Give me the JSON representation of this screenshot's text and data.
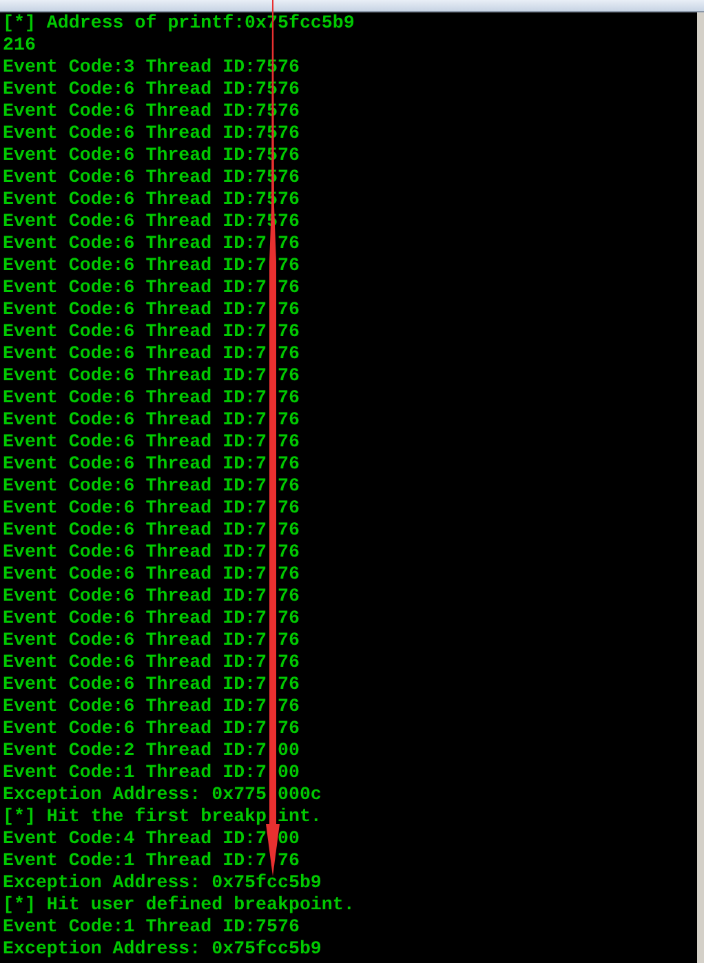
{
  "console": {
    "lines": [
      {
        "parts": [
          "[*] Address of printf:0x75fcc5b9"
        ]
      },
      {
        "parts": [
          "216"
        ]
      },
      {
        "parts": [
          "Event Code:3 Thread ID:7576"
        ]
      },
      {
        "parts": [
          "Event Code:6 Thread ID:7576"
        ]
      },
      {
        "parts": [
          "Event Code:6 Thread ID:7576"
        ]
      },
      {
        "parts": [
          "Event Code:6 Thread ID:7576"
        ]
      },
      {
        "parts": [
          "Event Code:6 Thread ID:7576"
        ]
      },
      {
        "parts": [
          "Event Code:6 Thread ID:7576"
        ]
      },
      {
        "parts": [
          "Event Code:6 Thread ID:7576"
        ]
      },
      {
        "parts": [
          "Event Code:6 Thread ID:7576"
        ]
      },
      {
        "parts": [
          "Event Code:6 Thread ID:7",
          "76"
        ]
      },
      {
        "parts": [
          "Event Code:6 Thread ID:7",
          "76"
        ]
      },
      {
        "parts": [
          "Event Code:6 Thread ID:7",
          "76"
        ]
      },
      {
        "parts": [
          "Event Code:6 Thread ID:7",
          "76"
        ]
      },
      {
        "parts": [
          "Event Code:6 Thread ID:7",
          "76"
        ]
      },
      {
        "parts": [
          "Event Code:6 Thread ID:7",
          "76"
        ]
      },
      {
        "parts": [
          "Event Code:6 Thread ID:7",
          "76"
        ]
      },
      {
        "parts": [
          "Event Code:6 Thread ID:7",
          "76"
        ]
      },
      {
        "parts": [
          "Event Code:6 Thread ID:7",
          "76"
        ]
      },
      {
        "parts": [
          "Event Code:6 Thread ID:7",
          "76"
        ]
      },
      {
        "parts": [
          "Event Code:6 Thread ID:7",
          "76"
        ]
      },
      {
        "parts": [
          "Event Code:6 Thread ID:7",
          "76"
        ]
      },
      {
        "parts": [
          "Event Code:6 Thread ID:7",
          "76"
        ]
      },
      {
        "parts": [
          "Event Code:6 Thread ID:7",
          "76"
        ]
      },
      {
        "parts": [
          "Event Code:6 Thread ID:7",
          "76"
        ]
      },
      {
        "parts": [
          "Event Code:6 Thread ID:7",
          "76"
        ]
      },
      {
        "parts": [
          "Event Code:6 Thread ID:7",
          "76"
        ]
      },
      {
        "parts": [
          "Event Code:6 Thread ID:7",
          "76"
        ]
      },
      {
        "parts": [
          "Event Code:6 Thread ID:7",
          "76"
        ]
      },
      {
        "parts": [
          "Event Code:6 Thread ID:7",
          "76"
        ]
      },
      {
        "parts": [
          "Event Code:6 Thread ID:7",
          "76"
        ]
      },
      {
        "parts": [
          "Event Code:6 Thread ID:7",
          "76"
        ]
      },
      {
        "parts": [
          "Event Code:6 Thread ID:7",
          "76"
        ]
      },
      {
        "parts": [
          "Event Code:2 Thread ID:7",
          "00"
        ]
      },
      {
        "parts": [
          "Event Code:1 Thread ID:7",
          "00"
        ]
      },
      {
        "parts": [
          "Exception Address: 0x775",
          "000c"
        ]
      },
      {
        "parts": [
          "[*] Hit the first breakp",
          "int."
        ]
      },
      {
        "parts": [
          "Event Code:4 Thread ID:7",
          "00"
        ]
      },
      {
        "parts": [
          "Event Code:1 Thread ID:7",
          "76"
        ]
      },
      {
        "parts": [
          "Exception Address: 0x75fcc5b9"
        ]
      },
      {
        "parts": [
          "[*] Hit user defined breakpoint."
        ]
      },
      {
        "parts": [
          "Event Code:1 Thread ID:7576"
        ]
      },
      {
        "parts": [
          "Exception Address: 0x75fcc5b9"
        ]
      }
    ]
  }
}
